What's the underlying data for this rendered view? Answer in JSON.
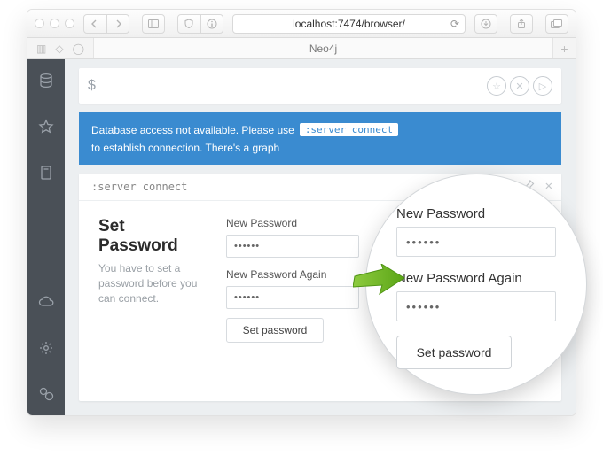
{
  "browser": {
    "url": "localhost:7474/browser/",
    "tab_title": "Neo4j"
  },
  "command_bar": {
    "prompt": "$",
    "value": ""
  },
  "banner": {
    "prefix": "Database access not available. Please use",
    "code": ":server connect",
    "suffix": "to establish connection. There's a graph"
  },
  "card": {
    "command": ":server connect",
    "heading": "Set Password",
    "description": "You have to set a password before you can connect.",
    "new_password_label": "New Password",
    "new_password_value": "••••••",
    "new_password_again_label": "New Password Again",
    "new_password_again_value": "••••••",
    "submit_label": "Set password"
  },
  "magnifier": {
    "new_password_label": "New Password",
    "new_password_value": "••••••",
    "new_password_again_label": "New Password Again",
    "new_password_again_value": "••••••",
    "submit_label": "Set password"
  }
}
